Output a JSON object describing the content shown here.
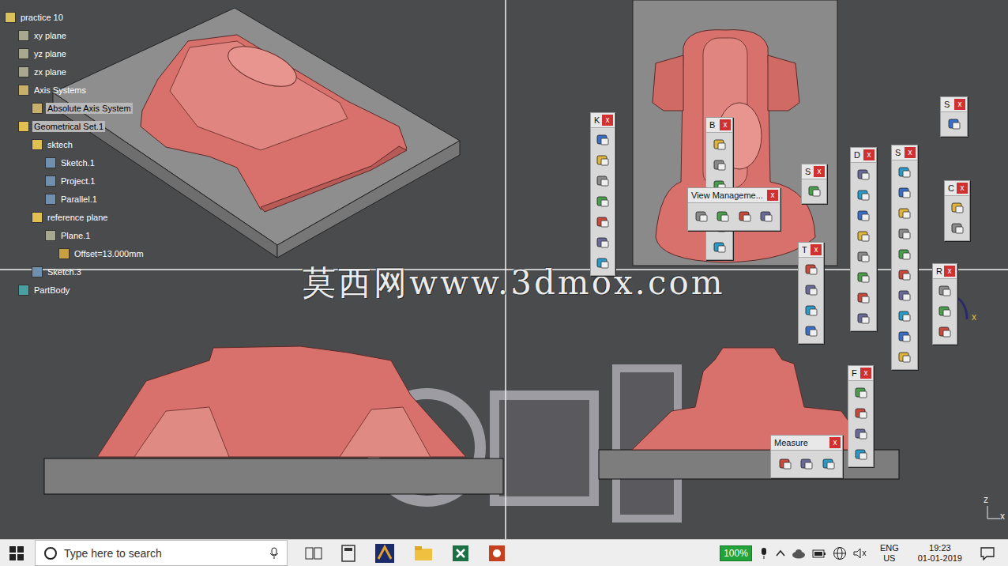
{
  "tree": [
    {
      "label": "practice 10",
      "depth": 0,
      "kind": "part",
      "selected": false
    },
    {
      "label": "xy plane",
      "depth": 1,
      "kind": "plane",
      "selected": false
    },
    {
      "label": "yz plane",
      "depth": 1,
      "kind": "plane",
      "selected": false
    },
    {
      "label": "zx plane",
      "depth": 1,
      "kind": "plane",
      "selected": false
    },
    {
      "label": "Axis Systems",
      "depth": 1,
      "kind": "axis",
      "selected": false
    },
    {
      "label": "Absolute Axis System",
      "depth": 2,
      "kind": "axis",
      "selected": true
    },
    {
      "label": "Geometrical Set.1",
      "depth": 1,
      "kind": "set",
      "selected": true
    },
    {
      "label": "sktech",
      "depth": 2,
      "kind": "set",
      "selected": false
    },
    {
      "label": "Sketch.1",
      "depth": 3,
      "kind": "sketch",
      "selected": false
    },
    {
      "label": "Project.1",
      "depth": 3,
      "kind": "sketch",
      "selected": false
    },
    {
      "label": "Parallel.1",
      "depth": 3,
      "kind": "sketch",
      "selected": false
    },
    {
      "label": "reference plane",
      "depth": 2,
      "kind": "set",
      "selected": false
    },
    {
      "label": "Plane.1",
      "depth": 3,
      "kind": "plane",
      "selected": false
    },
    {
      "label": "Offset=13.000mm",
      "depth": 4,
      "kind": "param",
      "selected": false
    },
    {
      "label": "Sketch.3",
      "depth": 2,
      "kind": "sketch",
      "selected": false
    },
    {
      "label": "PartBody",
      "depth": 1,
      "kind": "body",
      "selected": false
    }
  ],
  "toolbars": [
    {
      "title": "K",
      "close": "x"
    },
    {
      "title": "B",
      "close": "x"
    },
    {
      "title": "View Manageme...",
      "close": "x"
    },
    {
      "title": "S",
      "close": "x"
    },
    {
      "title": "T",
      "close": "x"
    },
    {
      "title": "D",
      "close": "x"
    },
    {
      "title": "S",
      "close": "x"
    },
    {
      "title": "S",
      "close": "x"
    },
    {
      "title": "C",
      "close": "x"
    },
    {
      "title": "R",
      "close": "x"
    },
    {
      "title": "F",
      "close": "x"
    },
    {
      "title": "Measure",
      "close": "x"
    }
  ],
  "watermark": "莫西网www.3dmox.com",
  "axes": {
    "compass_x": "x",
    "view_z": "z",
    "view_x": "x"
  },
  "taskbar": {
    "search_placeholder": "Type here to search",
    "battery": "100%",
    "language": "ENG",
    "region": "US",
    "time": "19:23",
    "date": "01-01-2019"
  }
}
